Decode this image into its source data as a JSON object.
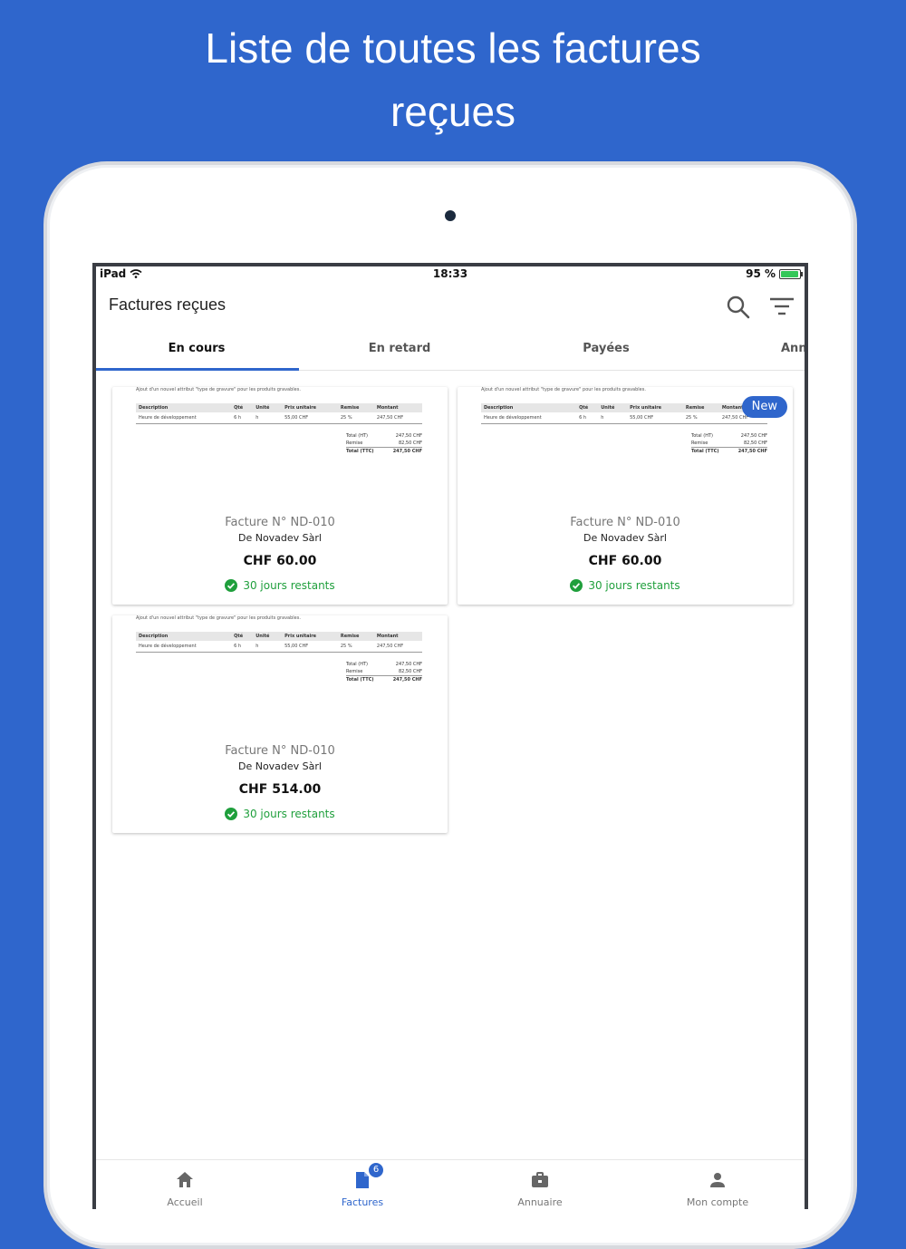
{
  "headline": {
    "line1": "Liste de toutes les factures",
    "line2": "reçues"
  },
  "status_bar": {
    "device": "iPad",
    "time": "18:33",
    "battery": "95 %",
    "battery_level": 0.95
  },
  "appbar": {
    "title": "Factures reçues",
    "search_icon": "search-icon",
    "filter_icon": "filter-icon"
  },
  "tabs": [
    {
      "label": "En cours",
      "active": true
    },
    {
      "label": "En retard",
      "active": false
    },
    {
      "label": "Payées",
      "active": false
    },
    {
      "label": "Annulées",
      "active": false
    }
  ],
  "invoice_preview": {
    "note": "Ajout d'un nouvel attribut \"type de gravure\" pour les produits gravables.",
    "columns": [
      "Description",
      "Qté",
      "Unité",
      "Prix unitaire",
      "Remise",
      "Montant"
    ],
    "row": [
      "Heure de développement",
      "6 h",
      "h",
      "55,00 CHF",
      "25 %",
      "247,50 CHF"
    ],
    "totals": [
      {
        "label": "Total (HT)",
        "value": "247,50 CHF"
      },
      {
        "label": "Remise",
        "value": "82,50 CHF"
      },
      {
        "label": "Total (TTC)",
        "value": "247,50 CHF"
      }
    ]
  },
  "invoices": [
    {
      "label": "Facture N° ND-010",
      "supplier": "De Novadev Sàrl",
      "amount": "CHF 60.00",
      "status": "30 jours restants",
      "is_new": false
    },
    {
      "label": "Facture N° ND-010",
      "supplier": "De Novadev Sàrl",
      "amount": "CHF 60.00",
      "status": "30 jours restants",
      "is_new": true,
      "badge": "New"
    },
    {
      "label": "Facture N° ND-010",
      "supplier": "De Novadev Sàrl",
      "amount": "CHF 514.00",
      "status": "30 jours restants",
      "is_new": false
    }
  ],
  "bottom_nav": [
    {
      "label": "Accueil",
      "icon": "home-icon",
      "active": false
    },
    {
      "label": "Factures",
      "icon": "invoice-icon",
      "active": true,
      "badge": "6"
    },
    {
      "label": "Annuaire",
      "icon": "briefcase-icon",
      "active": false
    },
    {
      "label": "Mon compte",
      "icon": "user-icon",
      "active": false
    }
  ],
  "colors": {
    "brand": "#2f66cc",
    "success": "#1f9f3c",
    "battery": "#34c759"
  }
}
